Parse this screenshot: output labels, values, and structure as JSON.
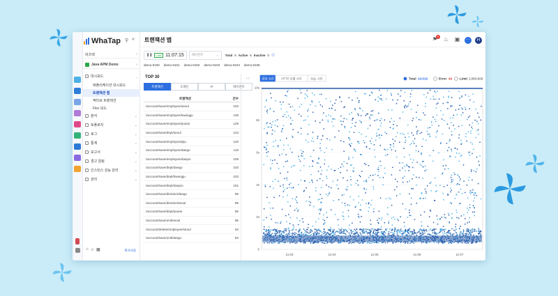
{
  "app": {
    "brand": "WhaTap",
    "section": "비즈텍",
    "project": "Java APM Demo"
  },
  "sidebar": {
    "items": [
      {
        "label": "대시보드",
        "expanded": true
      },
      {
        "label": "애플리케이션 대시보드",
        "sub": true
      },
      {
        "label": "트랜잭션 맵",
        "sub": true,
        "active": true
      },
      {
        "label": "액티브 트랜잭션",
        "sub": true
      },
      {
        "label": "Flex 보드",
        "sub": true
      },
      {
        "label": "분석"
      },
      {
        "label": "토폴로지"
      },
      {
        "label": "로그"
      },
      {
        "label": "통계"
      },
      {
        "label": "보고서"
      },
      {
        "label": "경고 알림"
      },
      {
        "label": "인스턴스 성능 관리"
      },
      {
        "label": "관리"
      }
    ],
    "footer_link": "회사사용"
  },
  "header": {
    "title": "트랜잭션 맵",
    "notif_count": "9",
    "user_initial": "H"
  },
  "controls": {
    "live": "LIVE",
    "time": "11:07:15",
    "agent_select": "에이전트",
    "total_label": "Total",
    "total": "6",
    "active_label": "Active",
    "active": "6",
    "inactive_label": "Inactive",
    "inactive": "0"
  },
  "agents": [
    "demo-0100",
    "demo-0101",
    "demo-0102",
    "demo-0103",
    "demo-0104",
    "demo-0105"
  ],
  "top": {
    "title": "TOP 30",
    "tabs": [
      "트랜잭션",
      "도메인",
      "IP",
      "에이전트"
    ],
    "col_tx": "트랜잭션",
    "col_count": "건수",
    "rows": [
      [
        "/account/save/employee/seoul",
        "153"
      ],
      [
        "/account/save/employee/kwangju",
        "136"
      ],
      [
        "/account/save/employee/pusan",
        "129"
      ],
      [
        "/account/save/dept/seoul",
        "123"
      ],
      [
        "/account/save/employee/jeju",
        "120"
      ],
      [
        "/account/save/employee/daegu",
        "115"
      ],
      [
        "/account/save/employee/daejun",
        "109"
      ],
      [
        "/account/save/dept/daegu",
        "103"
      ],
      [
        "/account/save/dept/kwangju",
        "103"
      ],
      [
        "/account/save/dept/daejun",
        "101"
      ],
      [
        "/account/save/division/daegu",
        "99"
      ],
      [
        "/account/save/division/seoul",
        "98"
      ],
      [
        "/account/save/dept/pusan",
        "96"
      ],
      [
        "/account/save/unit/seoul",
        "95"
      ],
      [
        "/account/delete/employee/seoul",
        "94"
      ],
      [
        "/account/save/unit/daegu",
        "94"
      ]
    ]
  },
  "chart": {
    "tabs": [
      "응답 시간",
      "HTTP 호출 시간",
      "SQL 시간"
    ],
    "total_label": "Total",
    "total": "24,519",
    "error_label": "Error",
    "error": "44",
    "limit_label": "Limit",
    "limit": "2,000,000"
  },
  "chart_data": {
    "type": "scatter",
    "y_ticks": [
      "0",
      "2s",
      "4s",
      "6s",
      "8s",
      "10s"
    ],
    "ylim": [
      0,
      10
    ],
    "x_ticks": [
      "11:03",
      "11:04",
      "11:05",
      "11:06",
      "11:07"
    ],
    "note": "dense band below 1s; sparse points up to 10s; line at 10s cap"
  },
  "colors": {
    "accent": "#2d6fe0",
    "live": "#2aa84a",
    "error": "#e0352b",
    "dot_dark": "#2a5dab",
    "dot_light": "#52b6e8"
  }
}
